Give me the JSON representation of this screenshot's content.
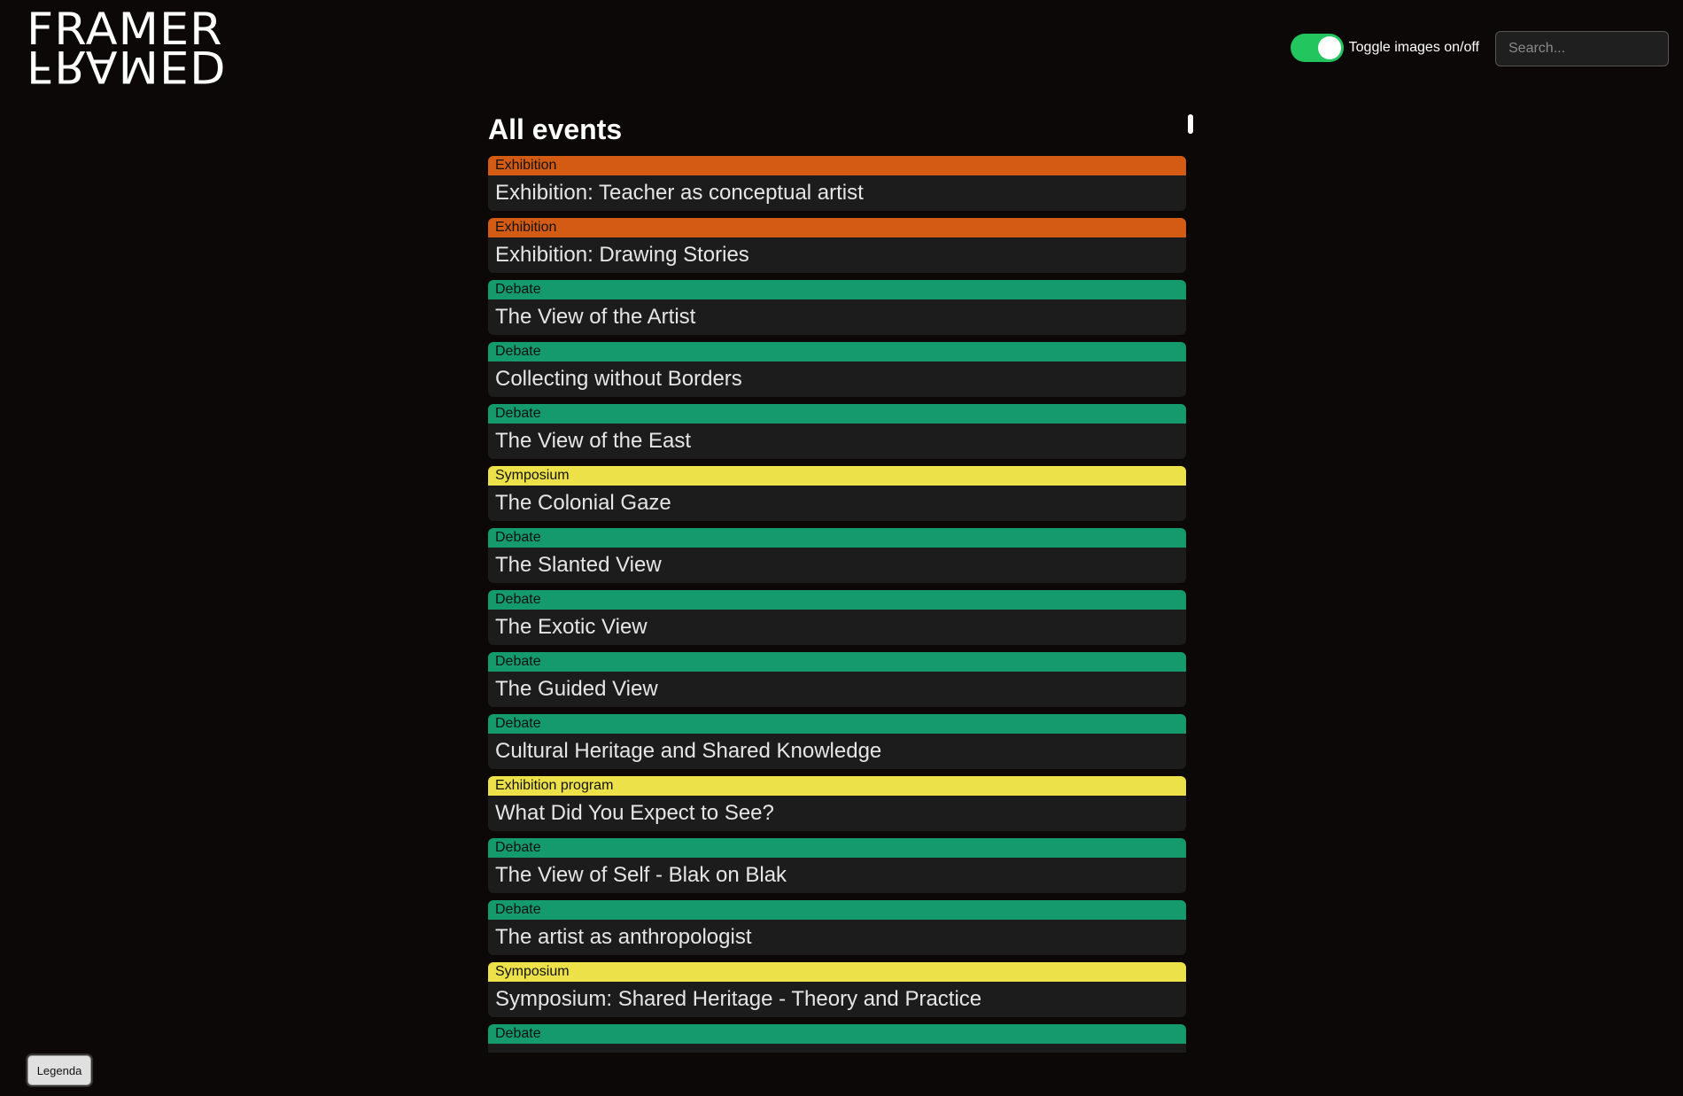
{
  "logo": {
    "line1": "FRAMER",
    "line2": "FRAMED"
  },
  "header": {
    "toggle_label": "Toggle images on/off",
    "toggle_on": true,
    "search_placeholder": "Search..."
  },
  "main": {
    "heading": "All events"
  },
  "colors": {
    "Exhibition": "#d45b14",
    "Debate": "#149a6c",
    "Symposium": "#ede14a",
    "Exhibition program": "#ede14a",
    "toggle_on": "#22c55e"
  },
  "events": [
    {
      "category": "Exhibition",
      "title": "Exhibition: Teacher as conceptual artist"
    },
    {
      "category": "Exhibition",
      "title": "Exhibition: Drawing Stories"
    },
    {
      "category": "Debate",
      "title": "The View of the Artist"
    },
    {
      "category": "Debate",
      "title": "Collecting without Borders"
    },
    {
      "category": "Debate",
      "title": "The View of the East"
    },
    {
      "category": "Symposium",
      "title": "The Colonial Gaze"
    },
    {
      "category": "Debate",
      "title": "The Slanted View"
    },
    {
      "category": "Debate",
      "title": "The Exotic View"
    },
    {
      "category": "Debate",
      "title": "The Guided View"
    },
    {
      "category": "Debate",
      "title": "Cultural Heritage and Shared Knowledge"
    },
    {
      "category": "Exhibition program",
      "title": "What Did You Expect to See?"
    },
    {
      "category": "Debate",
      "title": "The View of Self - Blak on Blak"
    },
    {
      "category": "Debate",
      "title": "The artist as anthropologist"
    },
    {
      "category": "Symposium",
      "title": "Symposium: Shared Heritage - Theory and Practice"
    },
    {
      "category": "Debate",
      "title": ""
    }
  ],
  "footer": {
    "legenda_label": "Legenda"
  }
}
